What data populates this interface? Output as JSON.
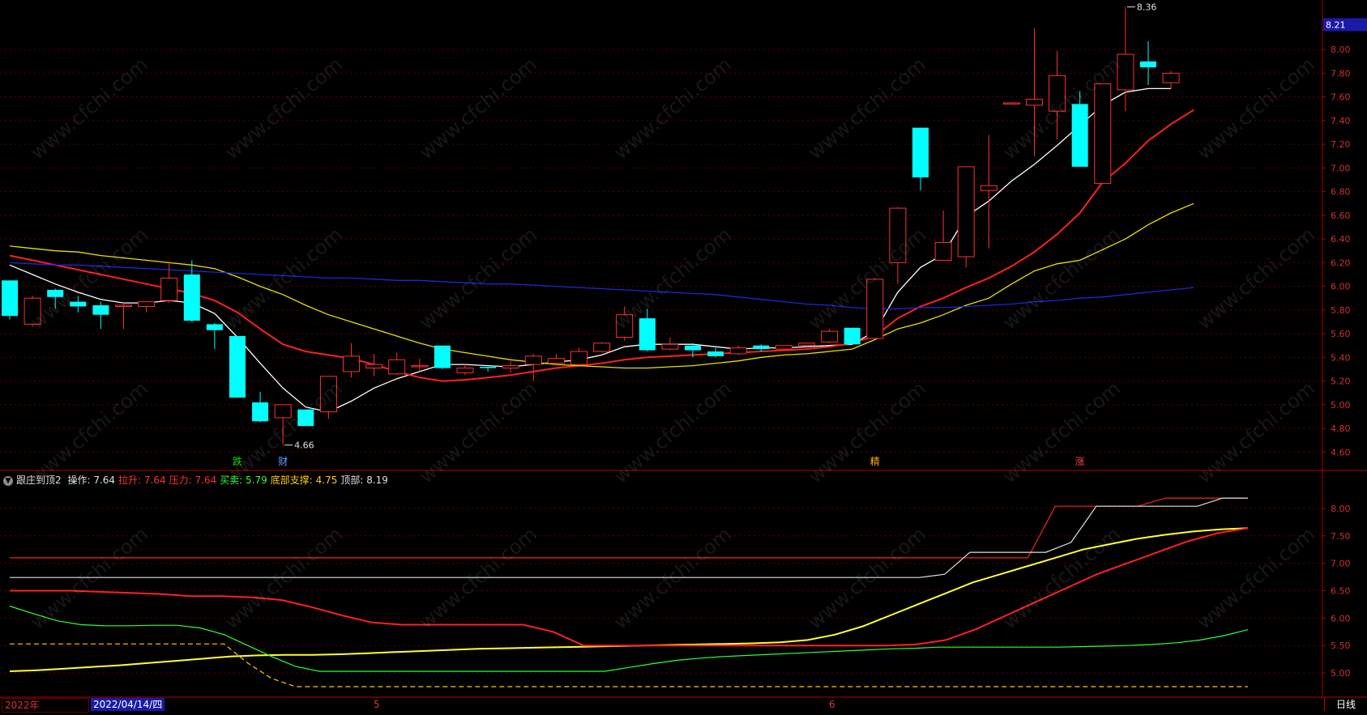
{
  "main": {
    "current_price_label": "8.21",
    "high_marker": "8.36",
    "low_marker": "4.66",
    "y_ticks": [
      "8.00",
      "7.80",
      "7.60",
      "7.40",
      "7.20",
      "7.00",
      "6.80",
      "6.60",
      "6.40",
      "6.20",
      "6.00",
      "5.80",
      "5.60",
      "5.40",
      "5.20",
      "5.00",
      "4.80",
      "4.60"
    ],
    "signals": [
      {
        "text": "跌",
        "color": "#00e000",
        "i": 10
      },
      {
        "text": "财",
        "color": "#6aa0ff",
        "i": 12
      },
      {
        "text": "精",
        "color": "#ffb000",
        "i": 38
      },
      {
        "text": "涨",
        "color": "#ff4040",
        "i": 47
      }
    ]
  },
  "indicator": {
    "name": "跟庄到顶2",
    "fields": [
      {
        "label": "操作:",
        "value": "7.64",
        "color": "#e0e0e0"
      },
      {
        "label": "拉升:",
        "value": "7.64",
        "color": "#ff3030"
      },
      {
        "label": "压力:",
        "value": "7.64",
        "color": "#ff3030"
      },
      {
        "label": "买卖:",
        "value": "5.79",
        "color": "#30ff30"
      },
      {
        "label": "底部支撑:",
        "value": "4.75",
        "color": "#ffcc00"
      },
      {
        "label": "顶部:",
        "value": "8.19",
        "color": "#e0e0e0"
      }
    ],
    "y_ticks": [
      "8.00",
      "7.50",
      "7.00",
      "6.50",
      "6.00",
      "5.50",
      "5.00"
    ]
  },
  "bottom": {
    "year_label": "2022年",
    "date_label": "2022/04/14/四",
    "month_marks": [
      "5",
      "6"
    ],
    "timeframe": "日线"
  },
  "watermark": "www.cfchi.com",
  "chart_data": [
    {
      "type": "candlestick",
      "title": "",
      "ylim": [
        4.52,
        8.35
      ],
      "up_color": "#ff3030",
      "down_color": "#00ffff",
      "candles": [
        {
          "o": 6.05,
          "h": 6.05,
          "c": 5.75,
          "l": 5.72
        },
        {
          "o": 5.68,
          "h": 5.92,
          "c": 5.9,
          "l": 5.66
        },
        {
          "o": 5.97,
          "h": 5.98,
          "c": 5.91,
          "l": 5.81
        },
        {
          "o": 5.87,
          "h": 5.92,
          "c": 5.83,
          "l": 5.78
        },
        {
          "o": 5.84,
          "h": 5.87,
          "c": 5.76,
          "l": 5.64
        },
        {
          "o": 5.84,
          "h": 5.87,
          "c": 5.84,
          "l": 5.64
        },
        {
          "o": 5.83,
          "h": 5.87,
          "c": 5.87,
          "l": 5.78
        },
        {
          "o": 5.88,
          "h": 6.21,
          "c": 6.07,
          "l": 5.86
        },
        {
          "o": 6.1,
          "h": 6.22,
          "c": 5.71,
          "l": 5.7
        },
        {
          "o": 5.68,
          "h": 5.69,
          "c": 5.63,
          "l": 5.47
        },
        {
          "o": 5.58,
          "h": 5.58,
          "c": 5.06,
          "l": 5.06
        },
        {
          "o": 5.02,
          "h": 5.11,
          "c": 4.86,
          "l": 4.85
        },
        {
          "o": 4.89,
          "h": 5.0,
          "c": 5.0,
          "l": 4.66
        },
        {
          "o": 4.96,
          "h": 4.96,
          "c": 4.82,
          "l": 4.82
        },
        {
          "o": 4.94,
          "h": 5.24,
          "c": 5.24,
          "l": 4.88
        },
        {
          "o": 5.28,
          "h": 5.52,
          "c": 5.41,
          "l": 5.23
        },
        {
          "o": 5.31,
          "h": 5.43,
          "c": 5.34,
          "l": 5.24
        },
        {
          "o": 5.26,
          "h": 5.44,
          "c": 5.38,
          "l": 5.25
        },
        {
          "o": 5.33,
          "h": 5.39,
          "c": 5.33,
          "l": 5.28
        },
        {
          "o": 5.5,
          "h": 5.5,
          "c": 5.31,
          "l": 5.3
        },
        {
          "o": 5.27,
          "h": 5.34,
          "c": 5.31,
          "l": 5.25
        },
        {
          "o": 5.32,
          "h": 5.32,
          "c": 5.31,
          "l": 5.28
        },
        {
          "o": 5.31,
          "h": 5.37,
          "c": 5.33,
          "l": 5.27
        },
        {
          "o": 5.34,
          "h": 5.43,
          "c": 5.41,
          "l": 5.2
        },
        {
          "o": 5.35,
          "h": 5.43,
          "c": 5.39,
          "l": 5.34
        },
        {
          "o": 5.34,
          "h": 5.48,
          "c": 5.45,
          "l": 5.33
        },
        {
          "o": 5.45,
          "h": 5.53,
          "c": 5.52,
          "l": 5.44
        },
        {
          "o": 5.57,
          "h": 5.83,
          "c": 5.76,
          "l": 5.54
        },
        {
          "o": 5.73,
          "h": 5.81,
          "c": 5.46,
          "l": 5.45
        },
        {
          "o": 5.47,
          "h": 5.57,
          "c": 5.51,
          "l": 5.46
        },
        {
          "o": 5.5,
          "h": 5.52,
          "c": 5.46,
          "l": 5.4
        },
        {
          "o": 5.45,
          "h": 5.48,
          "c": 5.41,
          "l": 5.4
        },
        {
          "o": 5.43,
          "h": 5.5,
          "c": 5.48,
          "l": 5.42
        },
        {
          "o": 5.5,
          "h": 5.51,
          "c": 5.47,
          "l": 5.45
        },
        {
          "o": 5.47,
          "h": 5.5,
          "c": 5.5,
          "l": 5.46
        },
        {
          "o": 5.5,
          "h": 5.51,
          "c": 5.52,
          "l": 5.48
        },
        {
          "o": 5.53,
          "h": 5.64,
          "c": 5.62,
          "l": 5.52
        },
        {
          "o": 5.65,
          "h": 5.65,
          "c": 5.51,
          "l": 5.51
        },
        {
          "o": 5.56,
          "h": 6.07,
          "c": 6.06,
          "l": 5.56
        },
        {
          "o": 6.2,
          "h": 6.67,
          "c": 6.66,
          "l": 6.02
        },
        {
          "o": 7.34,
          "h": 7.34,
          "c": 6.92,
          "l": 6.81
        },
        {
          "o": 6.22,
          "h": 6.64,
          "c": 6.37,
          "l": 6.22
        },
        {
          "o": 6.25,
          "h": 7.01,
          "c": 7.01,
          "l": 6.16
        },
        {
          "o": 6.81,
          "h": 7.28,
          "c": 6.85,
          "l": 6.32
        },
        {
          "o": 7.55,
          "h": 7.55,
          "c": 7.55,
          "l": 7.55
        },
        {
          "o": 7.53,
          "h": 8.18,
          "c": 7.58,
          "l": 7.1
        },
        {
          "o": 7.48,
          "h": 7.99,
          "c": 7.78,
          "l": 7.24
        },
        {
          "o": 7.54,
          "h": 7.65,
          "c": 7.01,
          "l": 7.01
        },
        {
          "o": 6.87,
          "h": 7.71,
          "c": 7.71,
          "l": 6.87
        },
        {
          "o": 7.66,
          "h": 8.36,
          "c": 7.96,
          "l": 7.48
        },
        {
          "o": 7.9,
          "h": 8.07,
          "c": 7.85,
          "l": 7.7
        },
        {
          "o": 7.72,
          "h": 7.82,
          "c": 7.8,
          "l": 7.67
        }
      ],
      "series": [
        {
          "color": "#ffffff",
          "values": [
            6.18,
            6.1,
            6.02,
            5.95,
            5.89,
            5.86,
            5.86,
            5.88,
            5.86,
            5.77,
            5.57,
            5.35,
            5.14,
            4.98,
            4.94,
            5.03,
            5.14,
            5.22,
            5.28,
            5.34,
            5.34,
            5.33,
            5.32,
            5.34,
            5.36,
            5.38,
            5.42,
            5.49,
            5.51,
            5.51,
            5.51,
            5.49,
            5.47,
            5.48,
            5.48,
            5.49,
            5.5,
            5.51,
            5.62,
            5.95,
            6.16,
            6.27,
            6.59,
            6.72,
            6.89,
            7.03,
            7.19,
            7.36,
            7.53,
            7.64,
            7.67,
            7.67
          ]
        },
        {
          "color": "#ff2020",
          "values": [
            6.26,
            6.22,
            6.18,
            6.14,
            6.1,
            6.06,
            6.02,
            5.98,
            5.94,
            5.88,
            5.78,
            5.64,
            5.51,
            5.45,
            5.42,
            5.39,
            5.34,
            5.28,
            5.23,
            5.2,
            5.21,
            5.23,
            5.25,
            5.28,
            5.31,
            5.33,
            5.35,
            5.38,
            5.4,
            5.41,
            5.42,
            5.43,
            5.44,
            5.45,
            5.46,
            5.47,
            5.49,
            5.52,
            5.58,
            5.73,
            5.83,
            5.9,
            5.99,
            6.07,
            6.17,
            6.29,
            6.44,
            6.62,
            6.88,
            7.04,
            7.23,
            7.37,
            7.49
          ]
        },
        {
          "color": "#e8e000",
          "values": [
            6.34,
            6.32,
            6.3,
            6.29,
            6.26,
            6.24,
            6.22,
            6.2,
            6.18,
            6.15,
            6.08,
            6.0,
            5.93,
            5.84,
            5.76,
            5.7,
            5.64,
            5.58,
            5.52,
            5.47,
            5.44,
            5.41,
            5.38,
            5.36,
            5.34,
            5.33,
            5.32,
            5.31,
            5.31,
            5.32,
            5.33,
            5.35,
            5.37,
            5.4,
            5.42,
            5.43,
            5.45,
            5.47,
            5.55,
            5.64,
            5.69,
            5.76,
            5.84,
            5.9,
            6.02,
            6.13,
            6.19,
            6.22,
            6.31,
            6.4,
            6.52,
            6.62,
            6.7
          ]
        },
        {
          "color": "#1a28d8",
          "values": [
            6.2,
            6.19,
            6.18,
            6.18,
            6.17,
            6.16,
            6.15,
            6.14,
            6.13,
            6.12,
            6.11,
            6.1,
            6.09,
            6.08,
            6.07,
            6.07,
            6.06,
            6.05,
            6.05,
            6.04,
            6.03,
            6.02,
            6.02,
            6.01,
            6.0,
            5.99,
            5.98,
            5.97,
            5.96,
            5.95,
            5.94,
            5.93,
            5.91,
            5.89,
            5.87,
            5.85,
            5.84,
            5.82,
            5.81,
            5.81,
            5.82,
            5.82,
            5.83,
            5.84,
            5.85,
            5.87,
            5.88,
            5.9,
            5.91,
            5.93,
            5.95,
            5.97,
            5.99
          ]
        }
      ]
    },
    {
      "type": "line",
      "title": "跟庄到顶2",
      "ylim": [
        4.75,
        8.25
      ],
      "series": [
        {
          "name": "操作",
          "color": "#ffff30",
          "values": [
            5.03,
            5.05,
            5.08,
            5.11,
            5.14,
            5.18,
            5.22,
            5.26,
            5.3,
            5.32,
            5.33,
            5.33,
            5.34,
            5.36,
            5.38,
            5.4,
            5.42,
            5.44,
            5.45,
            5.46,
            5.47,
            5.48,
            5.49,
            5.5,
            5.51,
            5.52,
            5.53,
            5.54,
            5.56,
            5.6,
            5.7,
            5.85,
            6.05,
            6.25,
            6.45,
            6.65,
            6.8,
            6.95,
            7.1,
            7.25,
            7.35,
            7.45,
            7.52,
            7.58,
            7.62,
            7.64
          ]
        },
        {
          "name": "拉升",
          "color": "#ff2020",
          "values": [
            6.5,
            6.5,
            6.5,
            6.48,
            6.46,
            6.44,
            6.4,
            6.4,
            6.38,
            6.33,
            6.2,
            6.05,
            5.92,
            5.88,
            5.88,
            5.88,
            5.88,
            5.88,
            5.75,
            5.5,
            5.5,
            5.5,
            5.5,
            5.5,
            5.5,
            5.5,
            5.5,
            5.5,
            5.5,
            5.5,
            5.52,
            5.6,
            5.8,
            6.05,
            6.3,
            6.55,
            6.8,
            7.0,
            7.2,
            7.4,
            7.55,
            7.64
          ]
        },
        {
          "name": "压力",
          "color": "#ff2020",
          "values": [
            7.1,
            7.1,
            7.1,
            7.1,
            7.1,
            7.1,
            7.1,
            7.1,
            7.1,
            7.1,
            7.1,
            7.1,
            7.1,
            7.1,
            7.1,
            7.1,
            7.1,
            7.1,
            7.1,
            7.1,
            7.1,
            7.1,
            7.1,
            7.1,
            7.1,
            7.1,
            7.1,
            7.1,
            7.1,
            7.1,
            7.1,
            7.1,
            7.1,
            7.1,
            7.1,
            7.1,
            7.1,
            7.1,
            8.04,
            8.04,
            8.04,
            8.04,
            8.19,
            8.19,
            8.19,
            8.19
          ]
        },
        {
          "name": "买卖",
          "color": "#30ff30",
          "values": [
            6.22,
            6.08,
            5.95,
            5.88,
            5.86,
            5.86,
            5.87,
            5.87,
            5.82,
            5.7,
            5.5,
            5.3,
            5.12,
            5.03,
            5.03,
            5.03,
            5.03,
            5.03,
            5.03,
            5.03,
            5.03,
            5.03,
            5.03,
            5.03,
            5.03,
            5.03,
            5.1,
            5.17,
            5.23,
            5.27,
            5.3,
            5.32,
            5.34,
            5.36,
            5.38,
            5.4,
            5.42,
            5.44,
            5.45,
            5.47,
            5.47,
            5.47,
            5.47,
            5.47,
            5.47,
            5.48,
            5.49,
            5.5,
            5.52,
            5.55,
            5.6,
            5.68,
            5.79
          ]
        },
        {
          "name": "底部支撑",
          "color": "#ffcc00",
          "values": [
            5.53,
            5.53,
            5.53,
            5.53,
            5.53,
            5.53,
            5.53,
            5.53,
            5.53,
            5.53,
            5.18,
            4.9,
            4.75,
            4.75,
            4.75,
            4.75,
            4.75,
            4.75,
            4.75,
            4.75,
            4.75,
            4.75,
            4.75,
            4.75,
            4.75,
            4.75,
            4.75,
            4.75,
            4.75,
            4.75,
            4.75,
            4.75,
            4.75,
            4.75,
            4.75,
            4.75,
            4.75,
            4.75,
            4.75,
            4.75,
            4.75,
            4.75,
            4.75,
            4.75,
            4.75,
            4.75,
            4.75,
            4.75,
            4.75,
            4.75,
            4.75,
            4.75,
            4.75
          ]
        },
        {
          "name": "顶部",
          "color": "#e0e0e0",
          "values": [
            6.74,
            6.74,
            6.74,
            6.74,
            6.74,
            6.74,
            6.74,
            6.74,
            6.74,
            6.74,
            6.74,
            6.74,
            6.74,
            6.74,
            6.74,
            6.74,
            6.74,
            6.74,
            6.74,
            6.74,
            6.74,
            6.74,
            6.74,
            6.74,
            6.74,
            6.74,
            6.74,
            6.74,
            6.74,
            6.74,
            6.74,
            6.74,
            6.74,
            6.74,
            6.74,
            6.74,
            6.74,
            6.8,
            7.2,
            7.2,
            7.2,
            7.2,
            7.38,
            8.04,
            8.04,
            8.04,
            8.04,
            8.04,
            8.19,
            8.19
          ]
        }
      ]
    }
  ]
}
